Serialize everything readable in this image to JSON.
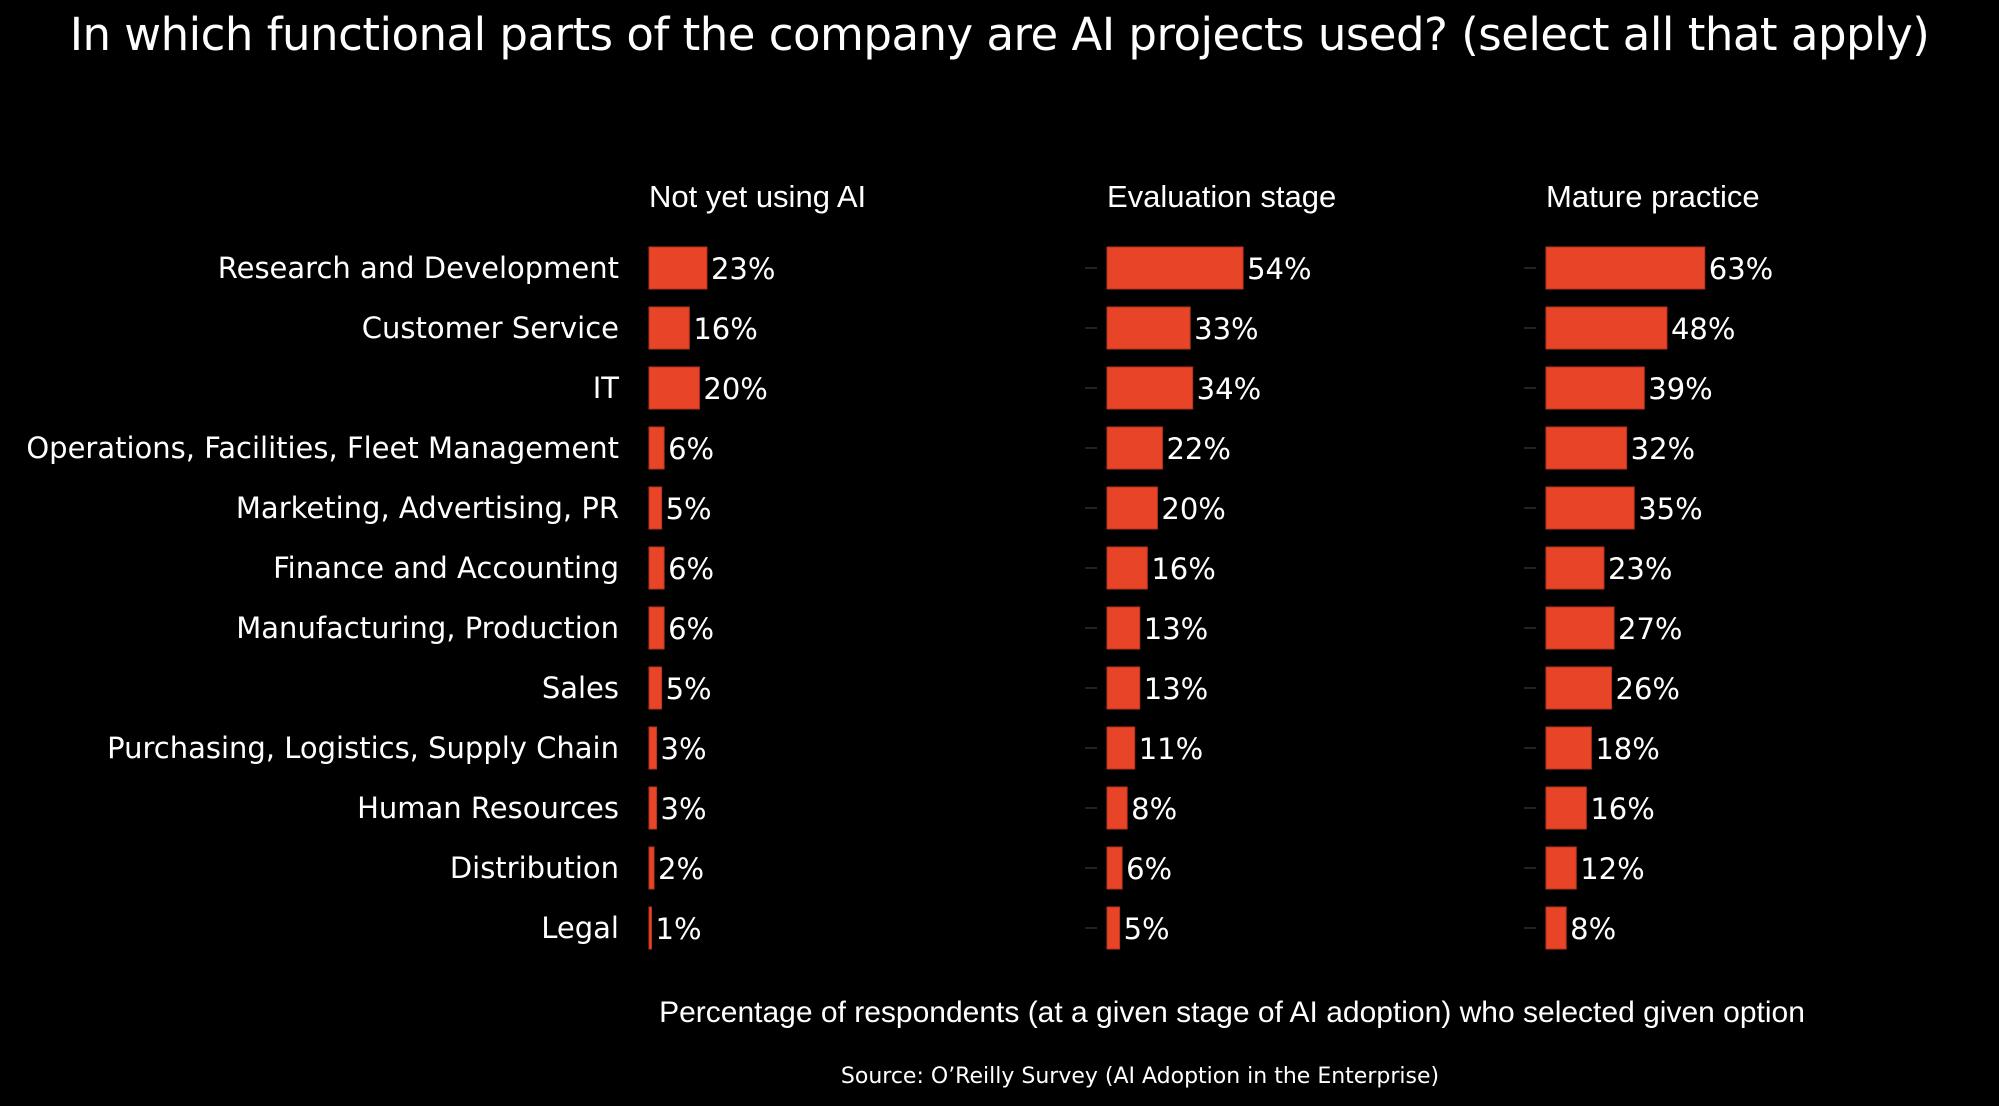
{
  "chart_data": {
    "type": "bar",
    "orientation": "horizontal",
    "layout": "small-multiples",
    "title": "In which functional parts of the company are AI projects used?  (select all that apply)",
    "xlabel": "Percentage of respondents (at a given stage of AI adoption) who selected given option",
    "ylabel": "",
    "source": "Source:  O’Reilly Survey (AI Adoption in the Enterprise)",
    "bar_color": "#E84427",
    "xlim": [
      0,
      100
    ],
    "grid": false,
    "categories": [
      "Research and Development",
      "Customer Service",
      "IT",
      "Operations, Facilities, Fleet Management",
      "Marketing, Advertising, PR",
      "Finance and Accounting",
      "Manufacturing, Production",
      "Sales",
      "Purchasing, Logistics, Supply Chain",
      "Human Resources",
      "Distribution",
      "Legal"
    ],
    "series": [
      {
        "name": "Not yet using AI",
        "values": [
          23,
          16,
          20,
          6,
          5,
          6,
          6,
          5,
          3,
          3,
          2,
          1
        ]
      },
      {
        "name": "Evaluation stage",
        "values": [
          54,
          33,
          34,
          22,
          20,
          16,
          13,
          13,
          11,
          8,
          6,
          5
        ]
      },
      {
        "name": "Mature practice",
        "values": [
          63,
          48,
          39,
          32,
          35,
          23,
          27,
          26,
          18,
          16,
          12,
          8
        ]
      }
    ],
    "value_suffix": "%"
  }
}
